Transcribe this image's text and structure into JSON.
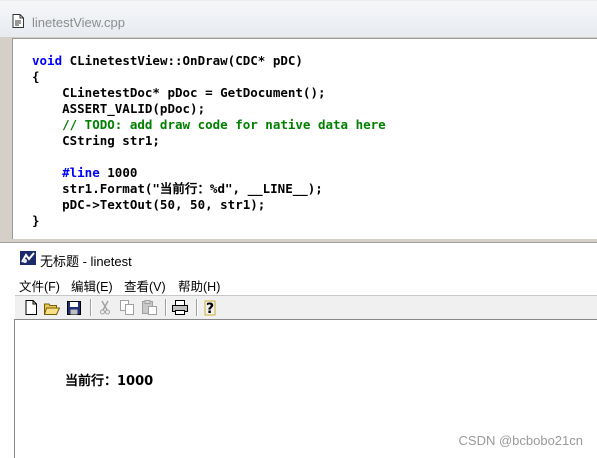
{
  "ide": {
    "tab_title": "linetestView.cpp",
    "code": [
      {
        "segments": [
          {
            "t": "void",
            "c": "kw"
          },
          {
            "t": " CLinetestView::OnDraw(CDC* pDC)",
            "c": ""
          }
        ]
      },
      {
        "segments": [
          {
            "t": "{",
            "c": ""
          }
        ]
      },
      {
        "segments": [
          {
            "t": "    CLinetestDoc* pDoc = GetDocument();",
            "c": ""
          }
        ]
      },
      {
        "segments": [
          {
            "t": "    ASSERT_VALID(pDoc);",
            "c": ""
          }
        ]
      },
      {
        "segments": [
          {
            "t": "    // TODO: add draw code for native data here",
            "c": "cm"
          }
        ]
      },
      {
        "segments": [
          {
            "t": "    CString str1;",
            "c": ""
          }
        ]
      },
      {
        "segments": [
          {
            "t": "",
            "c": ""
          }
        ]
      },
      {
        "segments": [
          {
            "t": "    ",
            "c": ""
          },
          {
            "t": "#line",
            "c": "kw"
          },
          {
            "t": " 1000",
            "c": ""
          }
        ]
      },
      {
        "segments": [
          {
            "t": "    str1.Format(\"当前行：%d\", __LINE__);",
            "c": ""
          }
        ]
      },
      {
        "segments": [
          {
            "t": "    pDC->TextOut(50, 50, str1);",
            "c": ""
          }
        ]
      },
      {
        "segments": [
          {
            "t": "}",
            "c": ""
          }
        ]
      }
    ]
  },
  "app": {
    "title": "无标题 - linetest",
    "menu": [
      "文件(F)",
      "编辑(E)",
      "查看(V)",
      "帮助(H)"
    ],
    "toolbar": [
      {
        "icon": "new-file-icon",
        "enabled": true
      },
      {
        "icon": "open-folder-icon",
        "enabled": true
      },
      {
        "icon": "save-icon",
        "enabled": true
      },
      {
        "sep": true
      },
      {
        "icon": "cut-icon",
        "enabled": false
      },
      {
        "icon": "copy-icon",
        "enabled": false
      },
      {
        "icon": "paste-icon",
        "enabled": false
      },
      {
        "sep": true
      },
      {
        "icon": "print-icon",
        "enabled": true
      },
      {
        "sep": true
      },
      {
        "icon": "help-icon",
        "enabled": true
      }
    ],
    "client_text": "当前行：1000"
  },
  "watermark": "CSDN @bcbobo21cn",
  "colors": {
    "keyword": "#0000ff",
    "comment": "#008000",
    "toolbar_bg": "#f0f0f0",
    "ide_bg": "#d4d0c8"
  }
}
